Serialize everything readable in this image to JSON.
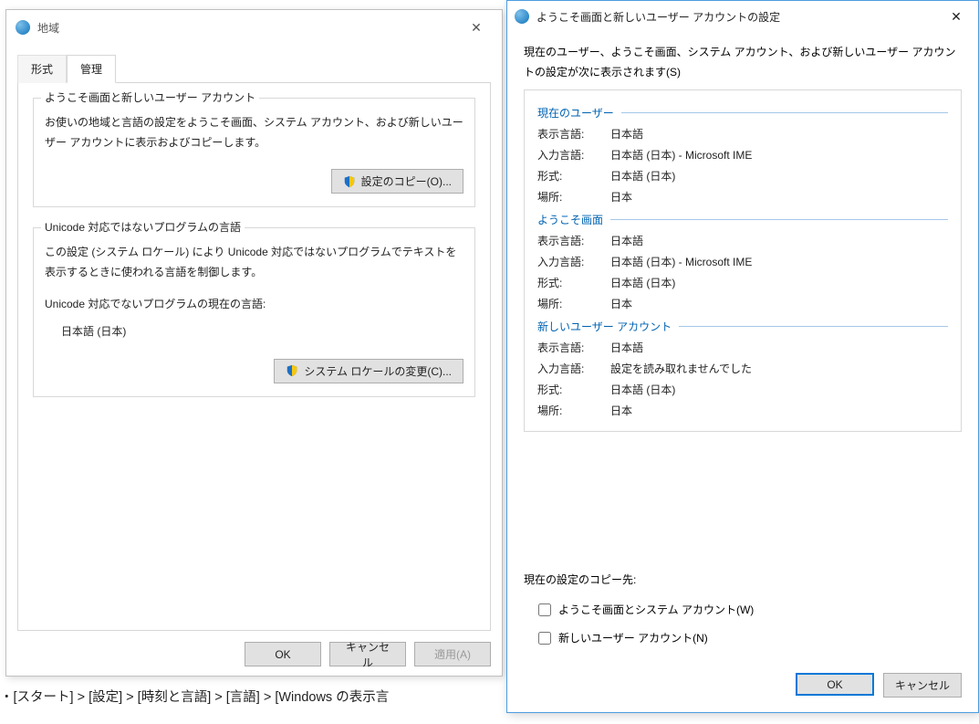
{
  "left": {
    "title": "地域",
    "tabs": {
      "format": "形式",
      "admin": "管理"
    },
    "group1": {
      "legend": "ようこそ画面と新しいユーザー アカウント",
      "desc": "お使いの地域と言語の設定をようこそ画面、システム アカウント、および新しいユーザー アカウントに表示およびコピーします。",
      "btn": "設定のコピー(O)..."
    },
    "group2": {
      "legend": "Unicode 対応ではないプログラムの言語",
      "desc": "この設定 (システム ロケール) により Unicode 対応ではないプログラムでテキストを表示するときに使われる言語を制御します。",
      "current_label": "Unicode 対応でないプログラムの現在の言語:",
      "current_value": "日本語 (日本)",
      "btn": "システム ロケールの変更(C)..."
    },
    "footer": {
      "ok": "OK",
      "cancel": "キャンセル",
      "apply": "適用(A)"
    }
  },
  "breadcrumb": "・[スタート] > [設定] > [時刻と言語] > [言語] > [Windows の表示言",
  "right": {
    "title": "ようこそ画面と新しいユーザー アカウントの設定",
    "intro": "現在のユーザー、ようこそ画面、システム アカウント、および新しいユーザー アカウントの設定が次に表示されます(S)",
    "labels": {
      "display_lang": "表示言語:",
      "input_lang": "入力言語:",
      "format": "形式:",
      "location": "場所:"
    },
    "sections": {
      "current": {
        "title": "現在のユーザー",
        "display_lang": "日本語",
        "input_lang": "日本語 (日本) - Microsoft IME",
        "format": "日本語 (日本)",
        "location": "日本"
      },
      "welcome": {
        "title": "ようこそ画面",
        "display_lang": "日本語",
        "input_lang": "日本語 (日本) - Microsoft IME",
        "format": "日本語 (日本)",
        "location": "日本"
      },
      "newuser": {
        "title": "新しいユーザー アカウント",
        "display_lang": "日本語",
        "input_lang": "設定を読み取れませんでした",
        "format": "日本語 (日本)",
        "location": "日本"
      }
    },
    "copy_dest": "現在の設定のコピー先:",
    "cb1": "ようこそ画面とシステム アカウント(W)",
    "cb2": "新しいユーザー アカウント(N)",
    "footer": {
      "ok": "OK",
      "cancel": "キャンセル"
    }
  }
}
